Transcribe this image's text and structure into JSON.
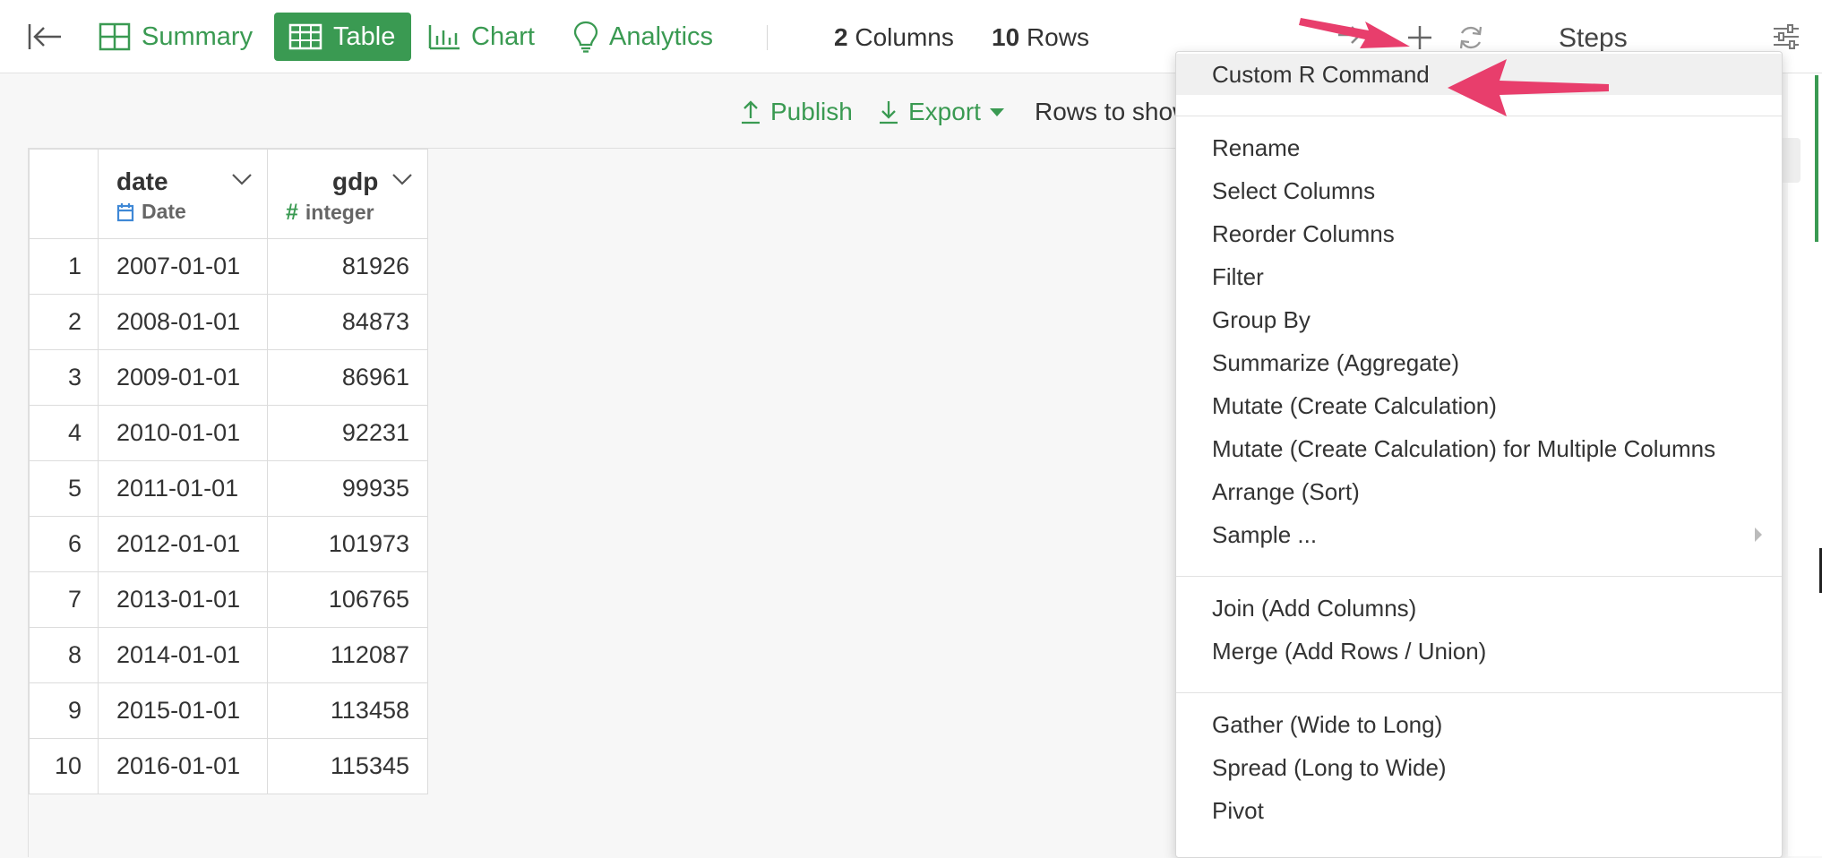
{
  "topbar": {
    "tabs": [
      {
        "label": "Summary",
        "active": false
      },
      {
        "label": "Table",
        "active": true
      },
      {
        "label": "Chart",
        "active": false
      },
      {
        "label": "Analytics",
        "active": false
      }
    ],
    "columns_count": "2",
    "columns_label": "Columns",
    "rows_count": "10",
    "rows_label": "Rows",
    "steps_title": "Steps"
  },
  "toolbar": {
    "publish_label": "Publish",
    "export_label": "Export",
    "rows_to_show_label": "Rows to show"
  },
  "table": {
    "columns": [
      {
        "name": "date",
        "type": "Date",
        "type_icon": "calendar-icon"
      },
      {
        "name": "gdp",
        "type": "integer",
        "type_icon": "hash-icon"
      }
    ],
    "rows": [
      {
        "idx": "1",
        "date": "2007-01-01",
        "gdp": "81926"
      },
      {
        "idx": "2",
        "date": "2008-01-01",
        "gdp": "84873"
      },
      {
        "idx": "3",
        "date": "2009-01-01",
        "gdp": "86961"
      },
      {
        "idx": "4",
        "date": "2010-01-01",
        "gdp": "92231"
      },
      {
        "idx": "5",
        "date": "2011-01-01",
        "gdp": "99935"
      },
      {
        "idx": "6",
        "date": "2012-01-01",
        "gdp": "101973"
      },
      {
        "idx": "7",
        "date": "2013-01-01",
        "gdp": "106765"
      },
      {
        "idx": "8",
        "date": "2014-01-01",
        "gdp": "112087"
      },
      {
        "idx": "9",
        "date": "2015-01-01",
        "gdp": "113458"
      },
      {
        "idx": "10",
        "date": "2016-01-01",
        "gdp": "115345"
      }
    ]
  },
  "menu": {
    "groups": [
      [
        "Custom R Command"
      ],
      [
        "Rename",
        "Select Columns",
        "Reorder Columns",
        "Filter",
        "Group By",
        "Summarize (Aggregate)",
        "Mutate (Create Calculation)",
        "Mutate (Create Calculation) for Multiple Columns",
        "Arrange (Sort)",
        "Sample ..."
      ],
      [
        "Join (Add Columns)",
        "Merge (Add Rows / Union)"
      ],
      [
        "Gather (Wide to Long)",
        "Spread (Long to Wide)",
        "Pivot"
      ]
    ],
    "highlighted": "Custom R Command"
  },
  "colors": {
    "accent": "#3a9a52",
    "annotation": "#e83e6c",
    "date_type": "#3f88d6"
  }
}
